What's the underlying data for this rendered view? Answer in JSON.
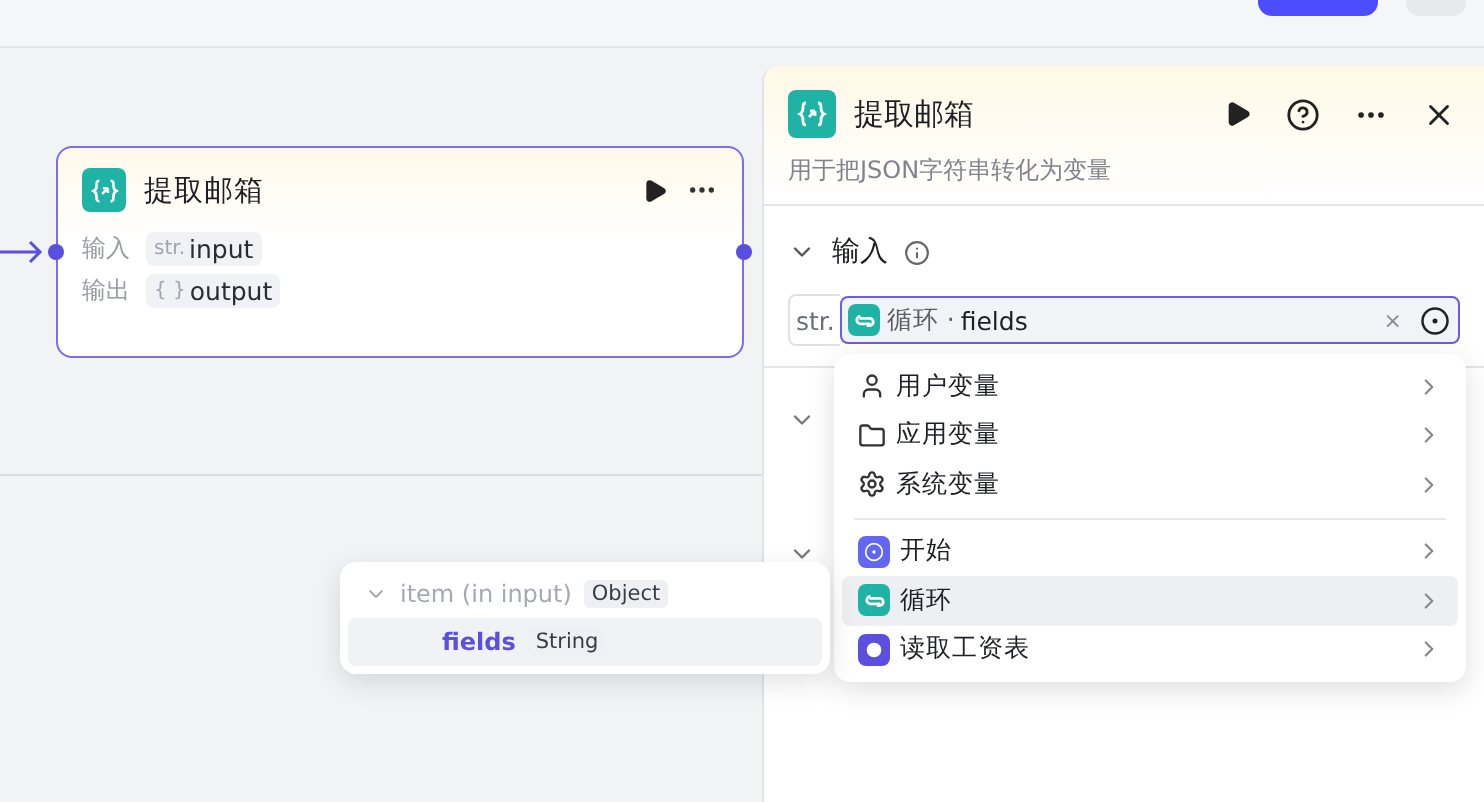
{
  "node": {
    "title": "提取邮箱",
    "ports": [
      {
        "label": "输入",
        "type": "str.",
        "name": "input"
      },
      {
        "label": "输出",
        "type": "{ }",
        "name": "output"
      }
    ]
  },
  "panel": {
    "title": "提取邮箱",
    "description": "用于把JSON字符串转化为变量",
    "section": {
      "label": "输入",
      "expanded": true
    },
    "field": {
      "type": "str.",
      "source": "循环",
      "separator": "·",
      "variable": "fields",
      "clear": "×"
    }
  },
  "menu": {
    "groups": [
      [
        {
          "label": "用户变量",
          "kind": "user",
          "selected": false
        },
        {
          "label": "应用变量",
          "kind": "folder",
          "selected": false
        },
        {
          "label": "系统变量",
          "kind": "gear",
          "selected": false
        }
      ],
      [
        {
          "label": "开始",
          "kind": "start",
          "selected": false
        },
        {
          "label": "循环",
          "kind": "loop",
          "selected": true
        },
        {
          "label": "读取工资表",
          "kind": "sheet",
          "selected": false
        }
      ]
    ]
  },
  "variable_tree": {
    "parent": {
      "label": "item (in input)",
      "type": "Object",
      "expanded": true
    },
    "children": [
      {
        "label": "fields",
        "type": "String",
        "selected": true
      }
    ]
  }
}
